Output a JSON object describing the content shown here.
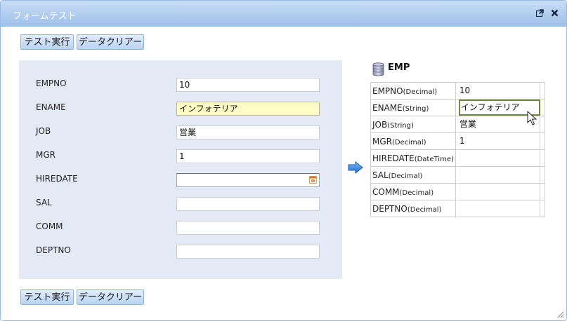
{
  "window": {
    "title": "フォームテスト"
  },
  "toolbar": {
    "run_label": "テスト実行",
    "clear_label": "データクリアー"
  },
  "form": {
    "fields": [
      {
        "label": "EMPNO",
        "value": "10"
      },
      {
        "label": "ENAME",
        "value": "インフォテリア"
      },
      {
        "label": "JOB",
        "value": "営業"
      },
      {
        "label": "MGR",
        "value": "1"
      },
      {
        "label": "HIREDATE",
        "value": ""
      },
      {
        "label": "SAL",
        "value": ""
      },
      {
        "label": "COMM",
        "value": ""
      },
      {
        "label": "DEPTNO",
        "value": ""
      }
    ]
  },
  "table": {
    "title": "EMP",
    "rows": [
      {
        "name": "EMPNO",
        "type": "(Decimal)",
        "value": "10"
      },
      {
        "name": "ENAME",
        "type": "(String)",
        "value": "インフォテリア"
      },
      {
        "name": "JOB",
        "type": "(String)",
        "value": "営業"
      },
      {
        "name": "MGR",
        "type": "(Decimal)",
        "value": "1"
      },
      {
        "name": "HIREDATE",
        "type": "(DateTime)",
        "value": ""
      },
      {
        "name": "SAL",
        "type": "(Decimal)",
        "value": ""
      },
      {
        "name": "COMM",
        "type": "(Decimal)",
        "value": ""
      },
      {
        "name": "DEPTNO",
        "type": "(Decimal)",
        "value": ""
      }
    ]
  },
  "icons": {
    "popout": "popout-icon",
    "close": "close-icon",
    "calendar": "calendar-icon",
    "arrow": "arrow-right-icon",
    "database": "database-icon",
    "cursor": "mouse-cursor-icon",
    "resize": "resize-grip-icon"
  },
  "colors": {
    "titlebar": "#9fc1ea",
    "form_panel": "#e4e9f6",
    "focused_field": "#fffbc4",
    "arrow": "#2f7fe0"
  }
}
